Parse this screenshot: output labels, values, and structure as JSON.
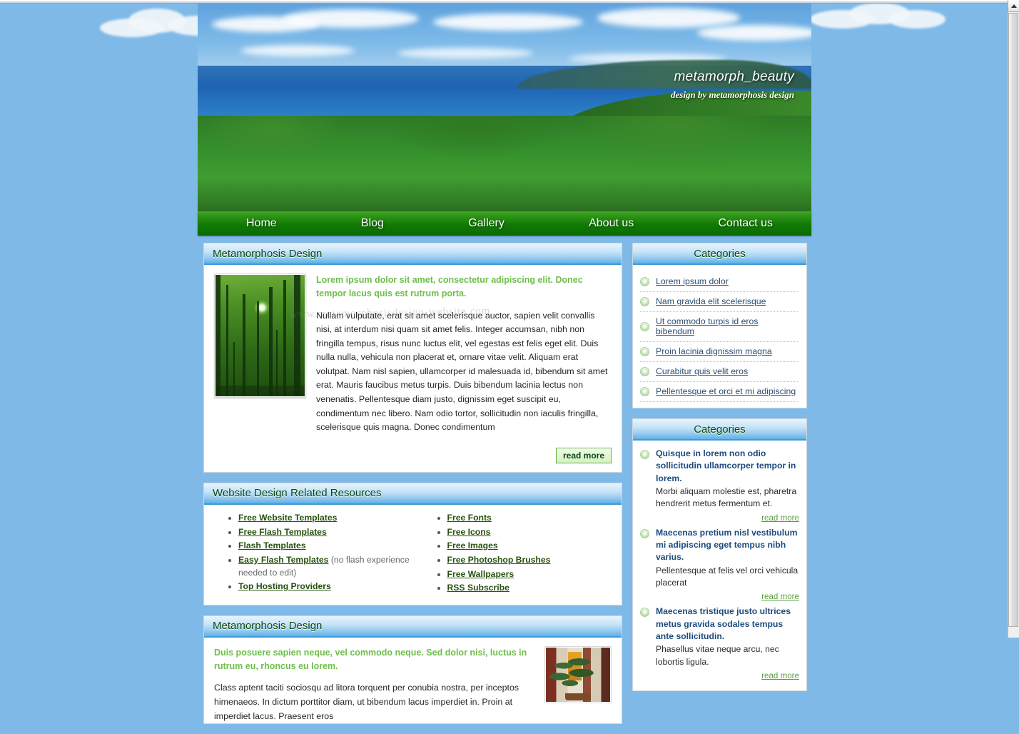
{
  "banner": {
    "site_title": "metamorph_beauty",
    "tagline": "design by metamorphosis design"
  },
  "nav": {
    "items": [
      {
        "label": "Home"
      },
      {
        "label": "Blog"
      },
      {
        "label": "Gallery"
      },
      {
        "label": "About us"
      },
      {
        "label": "Contact us"
      }
    ]
  },
  "main": {
    "article_top": {
      "header": "Metamorphosis Design",
      "image_alt": "forest-sunrays-photo",
      "lead": "Lorem ipsum dolor sit amet, consectetur adipiscing elit. Donec tempor lacus quis est rutrum porta.",
      "body": "Nullam vulputate, erat sit amet scelerisque auctor, sapien velit convallis nisi, at interdum nisi quam sit amet felis. Integer accumsan, nibh non fringilla tempus, risus nunc luctus elit, vel egestas est felis eget elit. Duis nulla nulla, vehicula non placerat et, ornare vitae velit. Aliquam erat volutpat. Nam nisl sapien, ullamcorper id malesuada id, bibendum sit amet erat. Mauris faucibus metus turpis. Duis bibendum lacinia lectus non venenatis. Pellentesque diam justo, dignissim eget suscipit eu, condimentum nec libero. Nam odio tortor, sollicitudin non iaculis fringilla, scelerisque quis magna. Donec condimentum",
      "watermark": "www.metamorphosisdesign-website.com",
      "read_more": "read more"
    },
    "resources": {
      "header": "Website Design Related Resources",
      "column_left": [
        {
          "label": "Free Website Templates",
          "note": ""
        },
        {
          "label": "Free Flash Templates",
          "note": ""
        },
        {
          "label": "Flash Templates",
          "note": ""
        },
        {
          "label": "Easy Flash Templates",
          "note": " (no flash experience needed to edit)"
        },
        {
          "label": "Top Hosting Providers",
          "note": ""
        }
      ],
      "column_right": [
        {
          "label": "Free Fonts",
          "note": ""
        },
        {
          "label": "Free Icons",
          "note": ""
        },
        {
          "label": "Free Images",
          "note": ""
        },
        {
          "label": "Free Photoshop Brushes",
          "note": ""
        },
        {
          "label": "Free Wallpapers",
          "note": ""
        },
        {
          "label": "RSS Subscribe",
          "note": ""
        }
      ]
    },
    "article_bottom": {
      "header": "Metamorphosis Design",
      "lead": "Duis posuere sapien neque, vel commodo neque. Sed dolor nisi, luctus in rutrum eu, rhoncus eu lorem.",
      "body": "Class aptent taciti sociosqu ad litora torquent per conubia nostra, per inceptos himenaeos. In dictum porttitor diam, ut bibendum lacus imperdiet in. Proin at imperdiet lacus. Praesent eros",
      "image_alt": "bonsai-tree-photo"
    }
  },
  "sidebar": {
    "categories_panel": {
      "header": "Categories",
      "items": [
        {
          "label": "Lorem ipsum dolor"
        },
        {
          "label": "Nam gravida elit scelerisque"
        },
        {
          "label": "Ut commodo turpis id eros bibendum"
        },
        {
          "label": "Proin lacinia dignissim magna"
        },
        {
          "label": "Curabitur quis velit eros"
        },
        {
          "label": "Pellentesque et orci et mi adipiscing"
        }
      ]
    },
    "news_panel": {
      "header": "Categories",
      "items": [
        {
          "title": "Quisque in lorem non odio sollicitudin ullamcorper tempor in lorem.",
          "desc": "Morbi aliquam molestie est, pharetra hendrerit metus fermentum et.",
          "read_more": "read more"
        },
        {
          "title": "Maecenas pretium nisl vestibulum mi adipiscing eget tempus nibh varius.",
          "desc": "Pellentesque at felis vel orci vehicula placerat",
          "read_more": "read more"
        },
        {
          "title": "Maecenas tristique justo ultrices metus gravida sodales tempus ante sollicitudin.",
          "desc": "Phasellus vitae neque arcu, nec lobortis ligula.",
          "read_more": "read more"
        }
      ]
    }
  },
  "colors": {
    "page_background": "#7fb9e8",
    "nav_green": "#117a05",
    "panel_header_blue": "#5fb0e6",
    "header_text_green": "#0b4a13",
    "lead_green": "#6ebe4b",
    "link_green": "#27520f",
    "sidebar_link_blue": "#2c4e72",
    "news_title_blue": "#1d4b7e"
  }
}
